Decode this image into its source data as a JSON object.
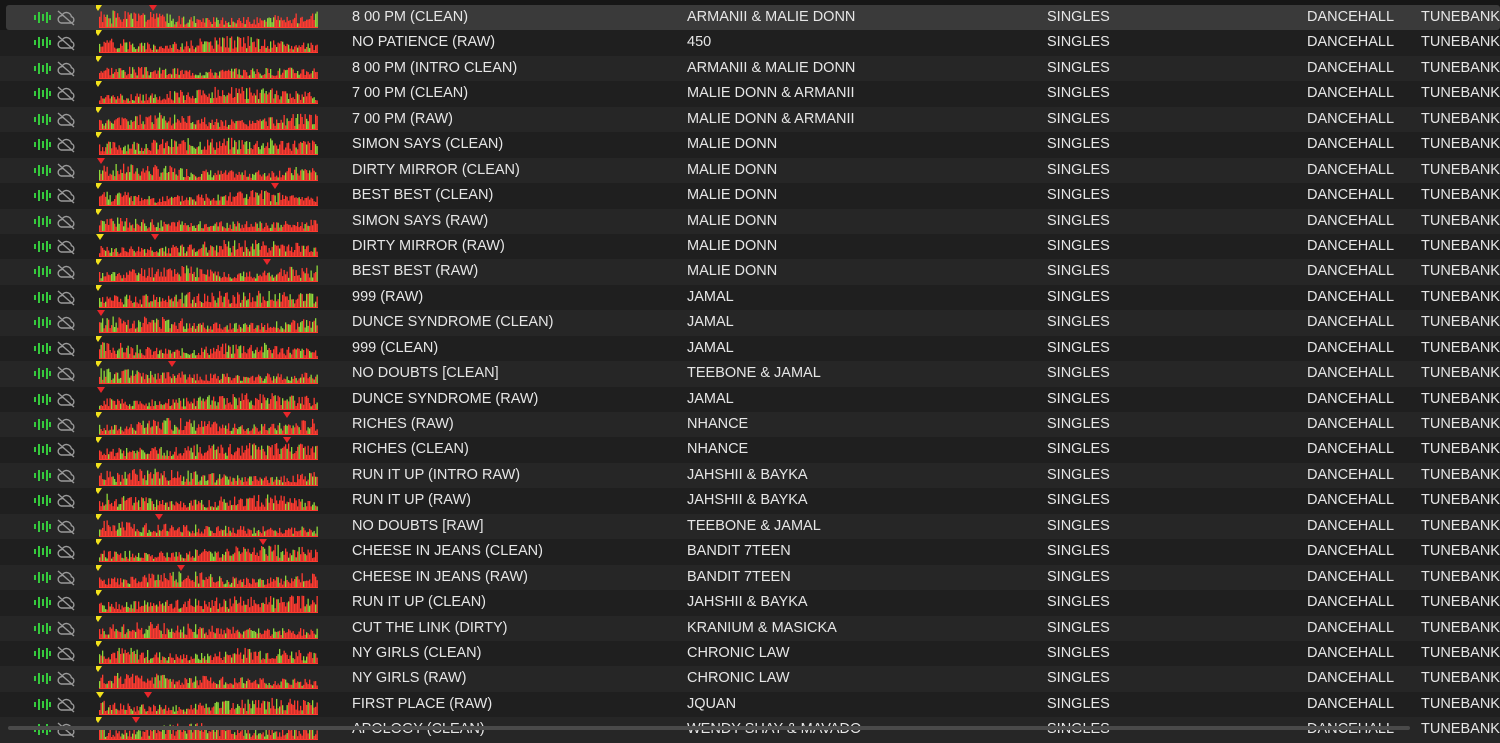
{
  "colors": {
    "analyze_icon": "#35c93d",
    "cloud_icon": "#9a9a9a",
    "wave_red": "#ff3a30",
    "wave_green": "#8ed83a",
    "cue_yellow": "#f2e21c",
    "cue_red": "#e8262a",
    "row_selected": "#3a3a3a"
  },
  "icons": {
    "analyze": "waveform-bars-icon",
    "cloud": "cloud-off-icon"
  },
  "tracks": [
    {
      "title": "8 00 PM (CLEAN)",
      "artist": "ARMANII & MALIE DONN",
      "album": "SINGLES",
      "genre": "DANCEHALL",
      "label": "TUNEBANK",
      "selected": true
    },
    {
      "title": "NO PATIENCE (RAW)",
      "artist": "450",
      "album": "SINGLES",
      "genre": "DANCEHALL",
      "label": "TUNEBANK"
    },
    {
      "title": "8 00 PM (INTRO CLEAN)",
      "artist": "ARMANII & MALIE DONN",
      "album": "SINGLES",
      "genre": "DANCEHALL",
      "label": "TUNEBANK"
    },
    {
      "title": "7 00 PM (CLEAN)",
      "artist": "MALIE DONN & ARMANII",
      "album": "SINGLES",
      "genre": "DANCEHALL",
      "label": "TUNEBANK"
    },
    {
      "title": "7 00 PM (RAW)",
      "artist": "MALIE DONN & ARMANII",
      "album": "SINGLES",
      "genre": "DANCEHALL",
      "label": "TUNEBANK"
    },
    {
      "title": "SIMON SAYS (CLEAN)",
      "artist": "MALIE DONN",
      "album": "SINGLES",
      "genre": "DANCEHALL",
      "label": "TUNEBANK"
    },
    {
      "title": "DIRTY MIRROR (CLEAN)",
      "artist": "MALIE DONN",
      "album": "SINGLES",
      "genre": "DANCEHALL",
      "label": "TUNEBANK"
    },
    {
      "title": "BEST BEST (CLEAN)",
      "artist": "MALIE DONN",
      "album": "SINGLES",
      "genre": "DANCEHALL",
      "label": "TUNEBANK"
    },
    {
      "title": "SIMON SAYS (RAW)",
      "artist": "MALIE DONN",
      "album": "SINGLES",
      "genre": "DANCEHALL",
      "label": "TUNEBANK"
    },
    {
      "title": "DIRTY MIRROR (RAW)",
      "artist": "MALIE DONN",
      "album": "SINGLES",
      "genre": "DANCEHALL",
      "label": "TUNEBANK"
    },
    {
      "title": "BEST BEST (RAW)",
      "artist": "MALIE DONN",
      "album": "SINGLES",
      "genre": "DANCEHALL",
      "label": "TUNEBANK"
    },
    {
      "title": "999 (RAW)",
      "artist": "JAMAL",
      "album": "SINGLES",
      "genre": "DANCEHALL",
      "label": "TUNEBANK"
    },
    {
      "title": "DUNCE SYNDROME (CLEAN)",
      "artist": "JAMAL",
      "album": "SINGLES",
      "genre": "DANCEHALL",
      "label": "TUNEBANK"
    },
    {
      "title": "999 (CLEAN)",
      "artist": "JAMAL",
      "album": "SINGLES",
      "genre": "DANCEHALL",
      "label": "TUNEBANK"
    },
    {
      "title": "NO DOUBTS [CLEAN]",
      "artist": "TEEBONE & JAMAL",
      "album": "SINGLES",
      "genre": "DANCEHALL",
      "label": "TUNEBANK"
    },
    {
      "title": "DUNCE SYNDROME (RAW)",
      "artist": "JAMAL",
      "album": "SINGLES",
      "genre": "DANCEHALL",
      "label": "TUNEBANK"
    },
    {
      "title": "RICHES (RAW)",
      "artist": "NHANCE",
      "album": "SINGLES",
      "genre": "DANCEHALL",
      "label": "TUNEBANK"
    },
    {
      "title": "RICHES (CLEAN)",
      "artist": "NHANCE",
      "album": "SINGLES",
      "genre": "DANCEHALL",
      "label": "TUNEBANK"
    },
    {
      "title": "RUN IT UP (INTRO RAW)",
      "artist": "JAHSHII & BAYKA",
      "album": "SINGLES",
      "genre": "DANCEHALL",
      "label": "TUNEBANK"
    },
    {
      "title": "RUN IT UP (RAW)",
      "artist": "JAHSHII & BAYKA",
      "album": "SINGLES",
      "genre": "DANCEHALL",
      "label": "TUNEBANK"
    },
    {
      "title": "NO DOUBTS [RAW]",
      "artist": "TEEBONE & JAMAL",
      "album": "SINGLES",
      "genre": "DANCEHALL",
      "label": "TUNEBANK"
    },
    {
      "title": "CHEESE IN JEANS (CLEAN)",
      "artist": "BANDIT 7TEEN",
      "album": "SINGLES",
      "genre": "DANCEHALL",
      "label": "TUNEBANK"
    },
    {
      "title": "CHEESE IN JEANS (RAW)",
      "artist": "BANDIT 7TEEN",
      "album": "SINGLES",
      "genre": "DANCEHALL",
      "label": "TUNEBANK"
    },
    {
      "title": "RUN IT UP (CLEAN)",
      "artist": "JAHSHII & BAYKA",
      "album": "SINGLES",
      "genre": "DANCEHALL",
      "label": "TUNEBANK"
    },
    {
      "title": "CUT THE LINK (DIRTY)",
      "artist": "KRANIUM & MASICKA",
      "album": "SINGLES",
      "genre": "DANCEHALL",
      "label": "TUNEBANK"
    },
    {
      "title": "NY GIRLS (CLEAN)",
      "artist": "CHRONIC LAW",
      "album": "SINGLES",
      "genre": "DANCEHALL",
      "label": "TUNEBANK"
    },
    {
      "title": "NY GIRLS (RAW)",
      "artist": "CHRONIC LAW",
      "album": "SINGLES",
      "genre": "DANCEHALL",
      "label": "TUNEBANK"
    },
    {
      "title": "FIRST PLACE (RAW)",
      "artist": "JQUAN",
      "album": "SINGLES",
      "genre": "DANCEHALL",
      "label": "TUNEBANK"
    },
    {
      "title": "APOLOGY (CLEAN)",
      "artist": "WENDY SHAY & MAVADO",
      "album": "SINGLES",
      "genre": "DANCEHALL",
      "label": "TUNEBANK"
    }
  ]
}
